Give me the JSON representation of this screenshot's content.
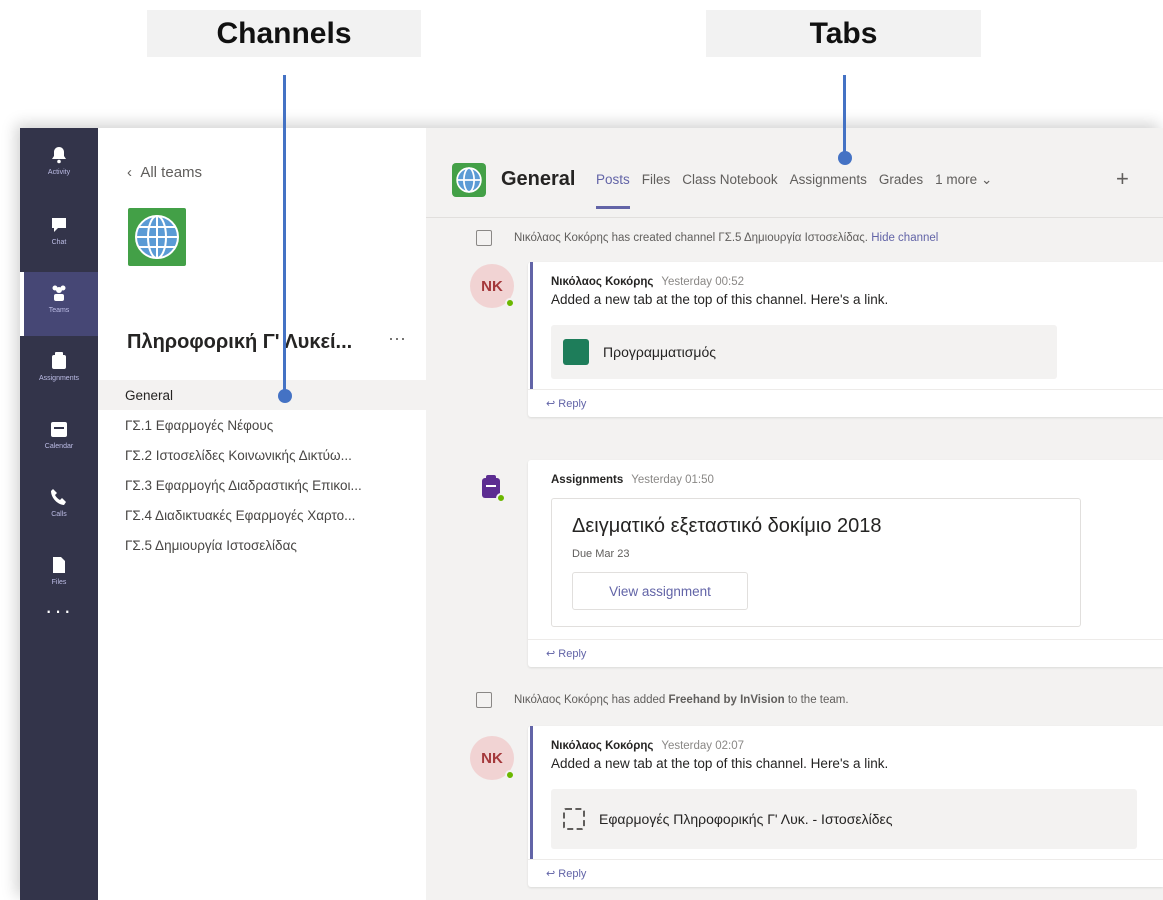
{
  "callouts": {
    "channels": "Channels",
    "tabs": "Tabs"
  },
  "rail": {
    "items": [
      {
        "label": "Activity",
        "icon": "bell-icon"
      },
      {
        "label": "Chat",
        "icon": "chat-icon"
      },
      {
        "label": "Teams",
        "icon": "teams-icon"
      },
      {
        "label": "Assignments",
        "icon": "assignments-icon"
      },
      {
        "label": "Calendar",
        "icon": "calendar-icon"
      },
      {
        "label": "Calls",
        "icon": "phone-icon"
      },
      {
        "label": "Files",
        "icon": "files-icon"
      }
    ],
    "more": "···"
  },
  "teams_pane": {
    "back_label": "All teams",
    "team_name": "Πληροφορική Γ' Λυκεί...",
    "more": "···",
    "channels": [
      "General",
      "ΓΣ.1 Εφαρμογές Νέφους",
      "ΓΣ.2 Ιστοσελίδες Κοινωνικής Δικτύω...",
      "ΓΣ.3 Εφαρμογής Διαδραστικής Επικοι...",
      "ΓΣ.4 Διαδικτυακές Εφαρμογές Χαρτο...",
      "ΓΣ.5 Δημιουργία Ιστοσελίδας"
    ],
    "active_channel": "General"
  },
  "header": {
    "channel_title": "General",
    "tabs": [
      "Posts",
      "Files",
      "Class Notebook",
      "Assignments",
      "Grades",
      "1 more ⌄"
    ],
    "active_tab": "Posts",
    "add_tab": "+"
  },
  "feed": {
    "system_1": {
      "text": "Νικόλαος Κοκόρης has created channel ΓΣ.5 Δημιουργία Ιστοσελίδας.",
      "link": "Hide channel"
    },
    "post_1": {
      "avatar": "NK",
      "author": "Νικόλαος Κοκόρης",
      "time": "Yesterday 00:52",
      "text": "Added a new tab at the top of this channel. Here's a link.",
      "card": "Προγραμματισμός",
      "reply": "↩ Reply"
    },
    "post_2": {
      "author": "Assignments",
      "time": "Yesterday 01:50",
      "title": "Δειγματικό εξεταστικό δοκίμιο 2018",
      "due": "Due Mar 23",
      "button": "View assignment",
      "reply": "↩ Reply"
    },
    "system_2": {
      "text_pre": "Νικόλαος Κοκόρης has added",
      "bold": "Freehand by InVision",
      "text_post": "to the team."
    },
    "post_3": {
      "avatar": "NK",
      "author": "Νικόλαος Κοκόρης",
      "time": "Yesterday 02:07",
      "text": "Added a new tab at the top of this channel. Here's a link.",
      "card": "Εφαρμογές Πληροφορικής Γ' Λυκ. - Ιστοσελίδες",
      "reply": "↩ Reply"
    }
  },
  "colors": {
    "accent": "#6264a7",
    "rail": "#33344a",
    "pointer": "#4472c4",
    "team_green": "#43a047"
  }
}
